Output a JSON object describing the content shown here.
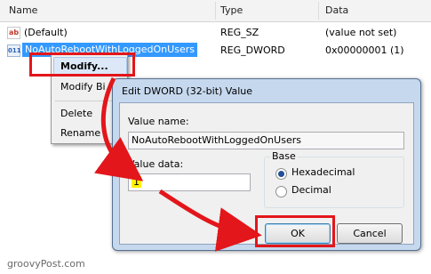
{
  "columns": {
    "name": "Name",
    "type": "Type",
    "data": "Data"
  },
  "rows": [
    {
      "icon": "string-value-icon",
      "glyph": "ab",
      "name": "(Default)",
      "type": "REG_SZ",
      "data": "(value not set)"
    },
    {
      "icon": "dword-value-icon",
      "glyph": "011",
      "name": "NoAutoRebootWithLoggedOnUsers",
      "type": "REG_DWORD",
      "data": "0x00000001 (1)"
    }
  ],
  "context_menu": {
    "items": [
      "Modify...",
      "Modify Bi",
      "Delete",
      "Rename"
    ]
  },
  "dialog": {
    "title": "Edit DWORD (32-bit) Value",
    "value_name_label": "Value name:",
    "value_name": "NoAutoRebootWithLoggedOnUsers",
    "value_data_label": "Value data:",
    "value_data": "1",
    "base_label": "Base",
    "hex_label": "Hexadecimal",
    "dec_label": "Decimal",
    "base_selected": "Hexadecimal",
    "ok_label": "OK",
    "cancel_label": "Cancel"
  },
  "watermark": "groovyPost.com",
  "colors": {
    "annotation_red": "#e3161b",
    "selection_blue": "#3399ff",
    "input_highlight": "#fff200"
  }
}
